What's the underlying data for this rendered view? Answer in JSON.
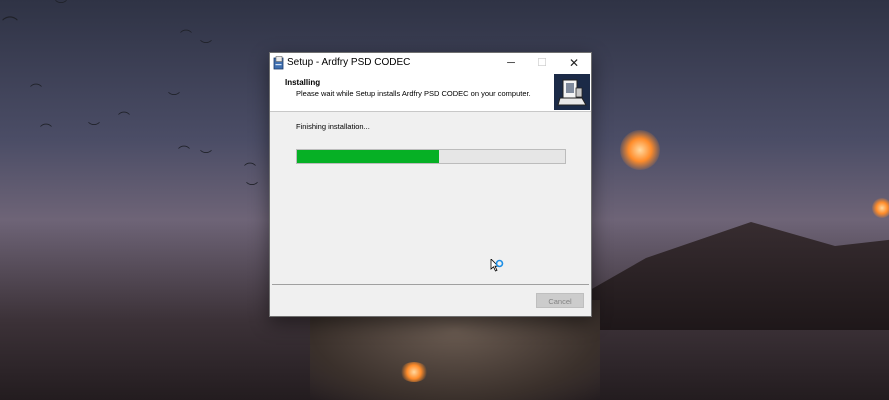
{
  "window": {
    "title": "Setup - Ardfry PSD CODEC",
    "minimize_glyph": "─",
    "maximize_glyph": "☐",
    "close_glyph": "✕"
  },
  "header": {
    "title": "Installing",
    "subtitle": "Please wait while Setup installs Ardfry PSD CODEC on your computer."
  },
  "progress": {
    "status": "Finishing installation...",
    "percent": 53,
    "fill_color": "#06b025"
  },
  "buttons": {
    "cancel": "Cancel"
  },
  "icons": [
    "setup-app-icon",
    "installer-header-image",
    "busy-cursor-icon"
  ]
}
